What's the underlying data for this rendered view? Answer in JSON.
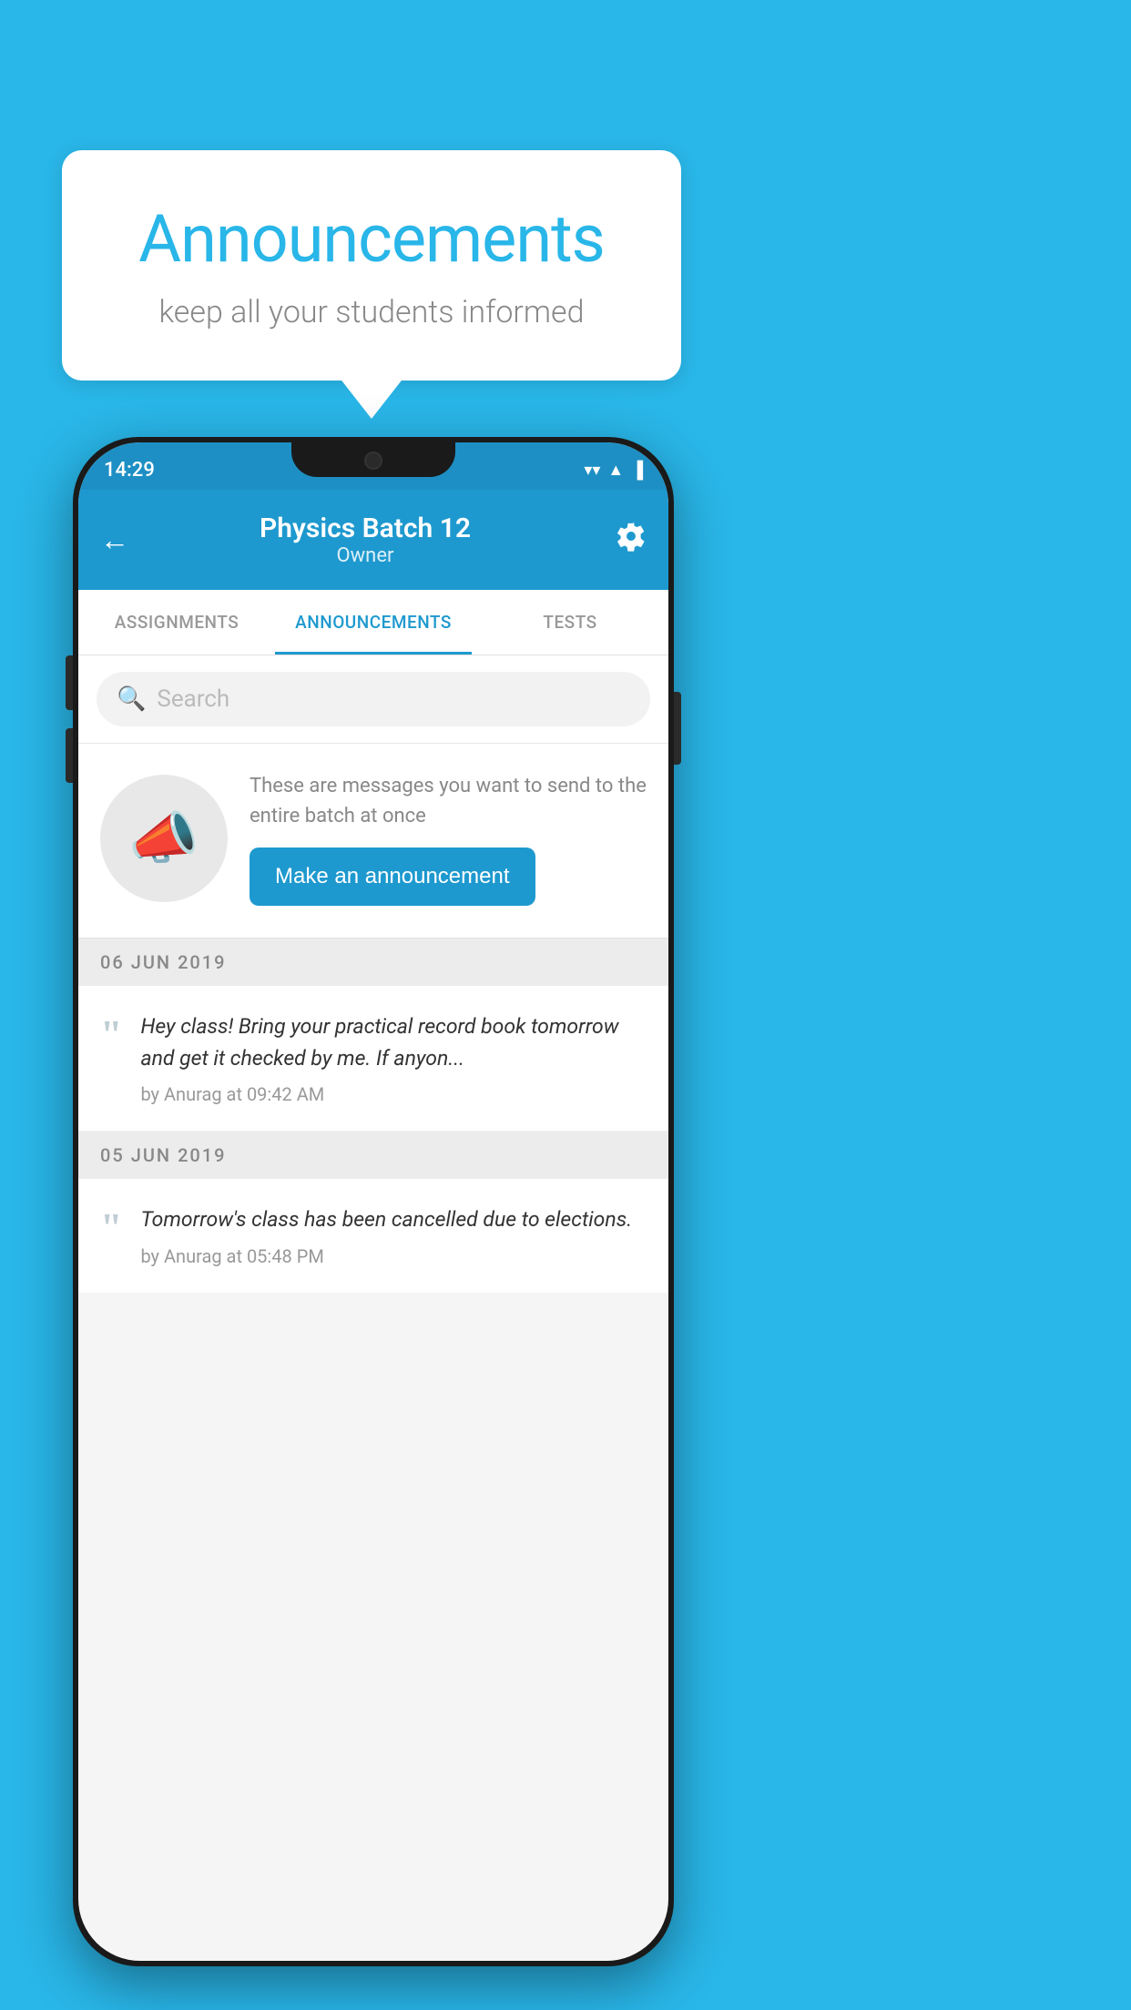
{
  "background_color": "#29B6E8",
  "speech_bubble": {
    "title": "Announcements",
    "subtitle": "keep all your students informed"
  },
  "status_bar": {
    "time": "14:29",
    "wifi_icon": "wifi",
    "signal_icon": "signal",
    "battery_icon": "battery"
  },
  "app_bar": {
    "back_label": "←",
    "title": "Physics Batch 12",
    "subtitle": "Owner",
    "settings_label": "⚙"
  },
  "tabs": [
    {
      "label": "ASSIGNMENTS",
      "active": false
    },
    {
      "label": "ANNOUNCEMENTS",
      "active": true
    },
    {
      "label": "TESTS",
      "active": false
    }
  ],
  "search": {
    "placeholder": "Search"
  },
  "promo": {
    "icon": "📣",
    "description": "These are messages you want to send to the entire batch at once",
    "button_label": "Make an announcement"
  },
  "date_groups": [
    {
      "date": "06  JUN  2019",
      "announcements": [
        {
          "text": "Hey class! Bring your practical record book tomorrow and get it checked by me. If anyon...",
          "meta": "by Anurag at 09:42 AM"
        }
      ]
    },
    {
      "date": "05  JUN  2019",
      "announcements": [
        {
          "text": "Tomorrow's class has been cancelled due to elections.",
          "meta": "by Anurag at 05:48 PM"
        }
      ]
    }
  ]
}
